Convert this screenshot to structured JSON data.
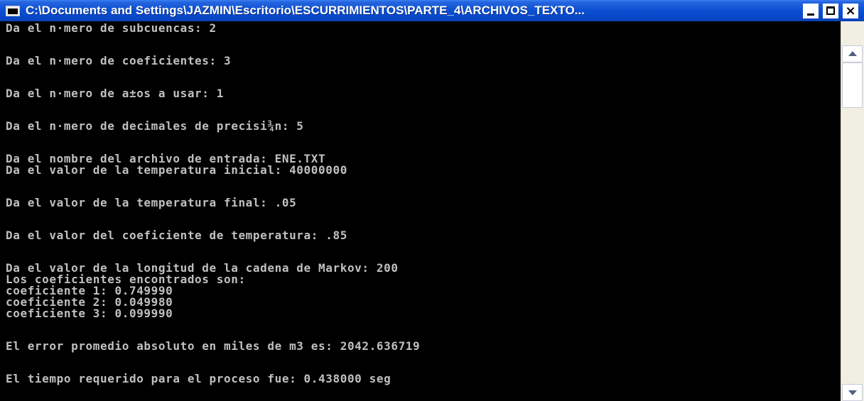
{
  "window": {
    "title": "C:\\Documents and Settings\\JAZMIN\\Escritorio\\ESCURRIMIENTOS\\PARTE_4\\ARCHIVOS_TEXTO...",
    "icon": "console-window-icon",
    "buttons": {
      "minimize": "minimize-icon",
      "maximize": "maximize-icon",
      "close_label": "×"
    }
  },
  "console": {
    "lines": [
      "Da el n·mero de subcuencas: 2",
      "Da el n·mero de coeficientes: 3",
      "Da el n·mero de a±os a usar: 1",
      "Da el n·mero de decimales de precisi¾n: 5",
      "Da el nombre del archivo de entrada: ENE.TXT",
      "Da el valor de la temperatura inicial: 40000000",
      "Da el valor de la temperatura final: .05",
      "Da el valor del coeficiente de temperatura: .85",
      "Da el valor de la longitud de la cadena de Markov: 200",
      "Los coeficientes encontrados son:",
      "coeficiente 1: 0.749990",
      "coeficiente 2: 0.049980",
      "coeficiente 3: 0.099990",
      "El error promedio absoluto en miles de m3 es: 2042.636719",
      "El tiempo requerido para el proceso fue: 0.438000 seg"
    ]
  },
  "colors": {
    "console_background": "#000000",
    "console_text": "#c0c0c0",
    "titlebar": "#0a4fd2"
  }
}
